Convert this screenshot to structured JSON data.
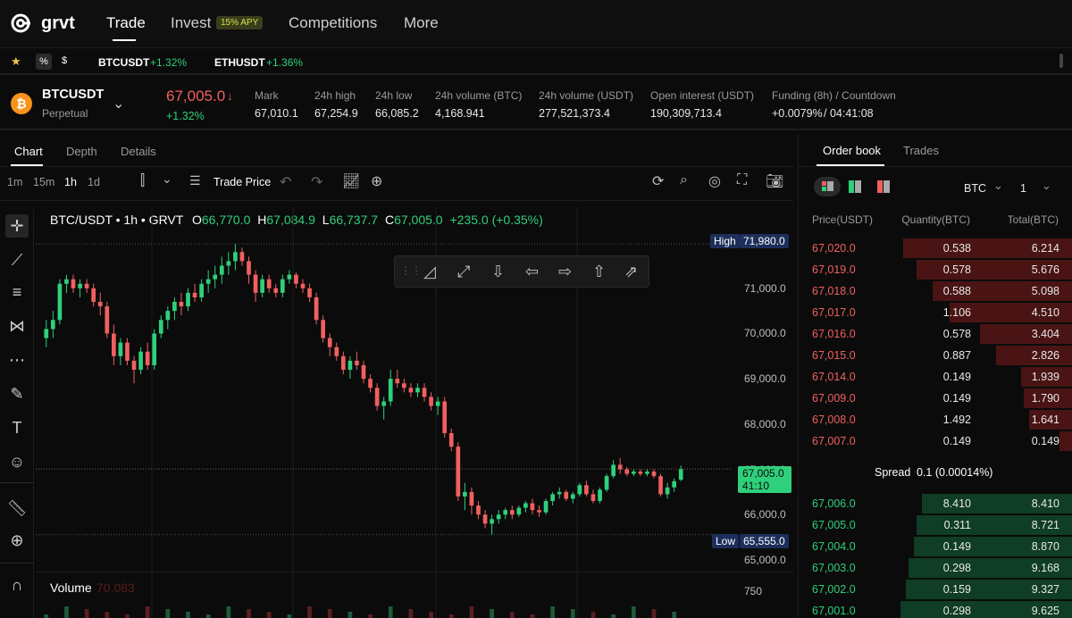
{
  "brand": {
    "name": "grvt"
  },
  "nav": {
    "items": [
      {
        "label": "Trade",
        "active": true
      },
      {
        "label": "Invest",
        "badge": "15% APY"
      },
      {
        "label": "Competitions"
      },
      {
        "label": "More"
      }
    ]
  },
  "ticker_strip": {
    "filters": [
      "%",
      "$"
    ],
    "pairs": [
      {
        "symbol": "BTCUSDT",
        "change": "+1.32%"
      },
      {
        "symbol": "ETHUSDT",
        "change": "+1.36%"
      }
    ]
  },
  "instrument": {
    "symbol": "BTCUSDT",
    "type": "Perpetual",
    "last_price": "67,005.0",
    "change": "+1.32%",
    "stats": [
      {
        "label": "Mark",
        "value": "67,010.1"
      },
      {
        "label": "24h high",
        "value": "67,254.9"
      },
      {
        "label": "24h low",
        "value": "66,085.2"
      },
      {
        "label": "24h volume (BTC)",
        "value": "4,168.941"
      },
      {
        "label": "24h volume (USDT)",
        "value": "277,521,373.4"
      },
      {
        "label": "Open interest (USDT)",
        "value": "190,309,713.4"
      },
      {
        "label": "Funding (8h) / Countdown",
        "value_green": "+0.0079%",
        "value": "/ 04:41:08"
      }
    ]
  },
  "chart_tabs": [
    "Chart",
    "Depth",
    "Details"
  ],
  "timeframes": [
    "1m",
    "15m",
    "1h",
    "1d"
  ],
  "active_timeframe": "1h",
  "price_source": "Trade Price",
  "chart_legend": {
    "title": "BTC/USDT • 1h • GRVT",
    "o_label": "O",
    "o": "66,770.0",
    "h_label": "H",
    "h": "67,084.9",
    "l_label": "L",
    "l": "66,737.7",
    "c_label": "C",
    "c": "67,005.0",
    "chg": "+235.0 (+0.35%)"
  },
  "chart_tags": {
    "high_label": "High",
    "high_value": "71,980.0",
    "low_label": "Low",
    "low_value": "65,555.0",
    "last_value": "67,005.0",
    "countdown": "41:10"
  },
  "volume": {
    "label": "Volume",
    "value": "70.083",
    "axis_label": "750"
  },
  "colors": {
    "up": "#2fd07b",
    "down": "#f0605e",
    "bg": "#0b0b0b"
  },
  "chart_data": {
    "type": "candlestick",
    "yaxis_ticks": [
      "71,000.0",
      "70,000.0",
      "69,000.0",
      "68,000.0",
      "67,000.0",
      "66,000.0",
      "65,000.0"
    ],
    "ylim": [
      64800,
      72200
    ],
    "ohlc": [
      [
        69900,
        70300,
        69700,
        70100
      ],
      [
        70100,
        70500,
        69900,
        70300
      ],
      [
        70300,
        71200,
        70200,
        71100
      ],
      [
        71100,
        71300,
        70900,
        71200
      ],
      [
        71200,
        71300,
        70900,
        71000
      ],
      [
        71000,
        71200,
        70800,
        71100
      ],
      [
        71100,
        71200,
        70900,
        71000
      ],
      [
        71000,
        71100,
        70600,
        70700
      ],
      [
        70700,
        70900,
        70400,
        70600
      ],
      [
        70600,
        70700,
        69900,
        70000
      ],
      [
        70000,
        70200,
        69300,
        69500
      ],
      [
        69500,
        69900,
        69300,
        69800
      ],
      [
        69800,
        69900,
        69300,
        69400
      ],
      [
        69400,
        69500,
        68900,
        69200
      ],
      [
        69200,
        69700,
        69100,
        69600
      ],
      [
        69600,
        69800,
        69200,
        69300
      ],
      [
        69300,
        70100,
        69200,
        70000
      ],
      [
        70000,
        70400,
        69900,
        70300
      ],
      [
        70300,
        70600,
        70100,
        70500
      ],
      [
        70500,
        70800,
        70300,
        70700
      ],
      [
        70700,
        70900,
        70400,
        70600
      ],
      [
        70600,
        71000,
        70500,
        70900
      ],
      [
        70900,
        71100,
        70700,
        70800
      ],
      [
        70800,
        71200,
        70700,
        71100
      ],
      [
        71100,
        71400,
        70900,
        71200
      ],
      [
        71200,
        71500,
        71000,
        71300
      ],
      [
        71300,
        71700,
        71100,
        71500
      ],
      [
        71500,
        71800,
        71300,
        71600
      ],
      [
        71600,
        71980,
        71400,
        71800
      ],
      [
        71800,
        71900,
        71500,
        71600
      ],
      [
        71600,
        71700,
        71100,
        71300
      ],
      [
        71300,
        71400,
        70700,
        70900
      ],
      [
        70900,
        71300,
        70800,
        71200
      ],
      [
        71200,
        71300,
        70900,
        71000
      ],
      [
        71000,
        71100,
        70800,
        70900
      ],
      [
        70900,
        71300,
        70800,
        71200
      ],
      [
        71200,
        71400,
        71100,
        71300
      ],
      [
        71300,
        71350,
        71000,
        71100
      ],
      [
        71100,
        71200,
        70900,
        71000
      ],
      [
        71000,
        71100,
        70700,
        70800
      ],
      [
        70800,
        70900,
        70200,
        70300
      ],
      [
        70300,
        70400,
        69800,
        69900
      ],
      [
        69900,
        70000,
        69500,
        69700
      ],
      [
        69700,
        69800,
        69400,
        69500
      ],
      [
        69500,
        69600,
        69100,
        69200
      ],
      [
        69200,
        69500,
        69000,
        69400
      ],
      [
        69400,
        69600,
        69200,
        69300
      ],
      [
        69300,
        69400,
        68900,
        69000
      ],
      [
        69000,
        69100,
        68700,
        68800
      ],
      [
        68800,
        68900,
        68300,
        68400
      ],
      [
        68400,
        68600,
        68100,
        68500
      ],
      [
        68500,
        69200,
        68400,
        69000
      ],
      [
        69000,
        69200,
        68800,
        68900
      ],
      [
        68900,
        69000,
        68700,
        68800
      ],
      [
        68800,
        68900,
        68600,
        68700
      ],
      [
        68700,
        68900,
        68600,
        68800
      ],
      [
        68800,
        68900,
        68500,
        68600
      ],
      [
        68600,
        68700,
        68300,
        68400
      ],
      [
        68400,
        68600,
        68200,
        68500
      ],
      [
        68500,
        68600,
        67700,
        67800
      ],
      [
        67800,
        67900,
        67400,
        67500
      ],
      [
        67500,
        67600,
        66300,
        66400
      ],
      [
        66400,
        66700,
        66100,
        66500
      ],
      [
        66500,
        66600,
        66000,
        66200
      ],
      [
        66200,
        66300,
        65900,
        66000
      ],
      [
        66000,
        66100,
        65700,
        65800
      ],
      [
        65800,
        66000,
        65555,
        65900
      ],
      [
        65900,
        66100,
        65800,
        66000
      ],
      [
        66000,
        66150,
        65900,
        66100
      ],
      [
        66100,
        66200,
        65900,
        66000
      ],
      [
        66000,
        66200,
        65950,
        66150
      ],
      [
        66150,
        66300,
        66050,
        66250
      ],
      [
        66250,
        66350,
        66000,
        66100
      ],
      [
        66100,
        66200,
        65950,
        66050
      ],
      [
        66050,
        66350,
        66000,
        66300
      ],
      [
        66300,
        66500,
        66200,
        66450
      ],
      [
        66450,
        66600,
        66350,
        66500
      ],
      [
        66500,
        66550,
        66300,
        66350
      ],
      [
        66350,
        66500,
        66250,
        66450
      ],
      [
        66450,
        66700,
        66400,
        66650
      ],
      [
        66650,
        66750,
        66400,
        66450
      ],
      [
        66450,
        66550,
        66250,
        66300
      ],
      [
        66300,
        66600,
        66250,
        66550
      ],
      [
        66550,
        66900,
        66500,
        66850
      ],
      [
        66850,
        67200,
        66800,
        67100
      ],
      [
        67100,
        67250,
        66900,
        67000
      ],
      [
        67000,
        67050,
        66850,
        66900
      ],
      [
        66900,
        67000,
        66850,
        66950
      ],
      [
        66950,
        67000,
        66850,
        66900
      ],
      [
        66900,
        67000,
        66850,
        66950
      ],
      [
        66950,
        67000,
        66800,
        66850
      ],
      [
        66850,
        66900,
        66400,
        66450
      ],
      [
        66450,
        66700,
        66350,
        66600
      ],
      [
        66600,
        66800,
        66500,
        66737
      ],
      [
        66770,
        67084,
        66737,
        67005
      ]
    ]
  },
  "orderbook": {
    "tabs": [
      "Order book",
      "Trades"
    ],
    "unit": "BTC",
    "group": "1",
    "headers": [
      "Price(USDT)",
      "Quantity(BTC)",
      "Total(BTC)"
    ],
    "asks": [
      {
        "price": "67,020.0",
        "qty": "0.538",
        "total": "6.214",
        "depth": 0.62
      },
      {
        "price": "67,019.0",
        "qty": "0.578",
        "total": "5.676",
        "depth": 0.57
      },
      {
        "price": "67,018.0",
        "qty": "0.588",
        "total": "5.098",
        "depth": 0.51
      },
      {
        "price": "67,017.0",
        "qty": "1.106",
        "total": "4.510",
        "depth": 0.45
      },
      {
        "price": "67,016.0",
        "qty": "0.578",
        "total": "3.404",
        "depth": 0.34
      },
      {
        "price": "67,015.0",
        "qty": "0.887",
        "total": "2.826",
        "depth": 0.28
      },
      {
        "price": "67,014.0",
        "qty": "0.149",
        "total": "1.939",
        "depth": 0.19
      },
      {
        "price": "67,009.0",
        "qty": "0.149",
        "total": "1.790",
        "depth": 0.18
      },
      {
        "price": "67,008.0",
        "qty": "1.492",
        "total": "1.641",
        "depth": 0.16
      },
      {
        "price": "67,007.0",
        "qty": "0.149",
        "total": "0.149",
        "depth": 0.05
      }
    ],
    "spread_label": "Spread",
    "spread_value": "0.1 (0.00014%)",
    "bids": [
      {
        "price": "67,006.0",
        "qty": "8.410",
        "total": "8.410",
        "depth": 0.55
      },
      {
        "price": "67,005.0",
        "qty": "0.311",
        "total": "8.721",
        "depth": 0.57
      },
      {
        "price": "67,004.0",
        "qty": "0.149",
        "total": "8.870",
        "depth": 0.58
      },
      {
        "price": "67,003.0",
        "qty": "0.298",
        "total": "9.168",
        "depth": 0.6
      },
      {
        "price": "67,002.0",
        "qty": "0.159",
        "total": "9.327",
        "depth": 0.61
      },
      {
        "price": "67,001.0",
        "qty": "0.298",
        "total": "9.625",
        "depth": 0.63
      }
    ]
  }
}
